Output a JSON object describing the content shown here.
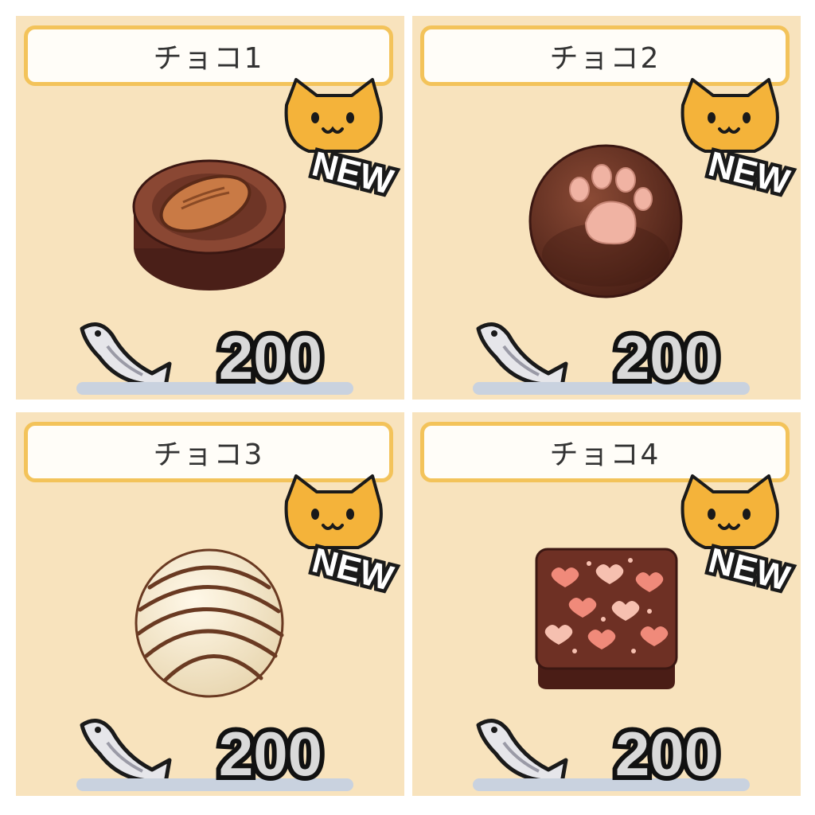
{
  "items": [
    {
      "name": "チョコ1",
      "badge": "NEW",
      "price": "200",
      "art": "almond-chocolate"
    },
    {
      "name": "チョコ2",
      "badge": "NEW",
      "price": "200",
      "art": "paw-chocolate"
    },
    {
      "name": "チョコ3",
      "badge": "NEW",
      "price": "200",
      "art": "striped-truffle"
    },
    {
      "name": "チョコ4",
      "badge": "NEW",
      "price": "200",
      "art": "heart-square-chocolate"
    }
  ],
  "currency_icon": "dried-fish-icon",
  "colors": {
    "card_bg": "#f8e3bd",
    "name_border": "#f3c35a",
    "cat_badge": "#f4b33a",
    "price_text": "#d9d9d9",
    "price_outline": "#111111",
    "bar": "#c9d2df"
  }
}
